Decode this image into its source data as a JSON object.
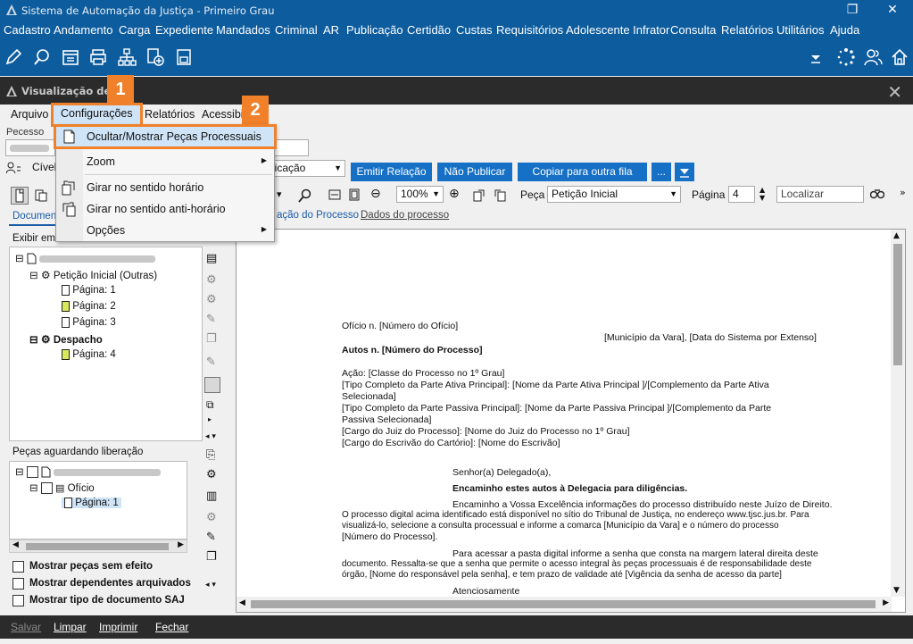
{
  "window": {
    "title": "Sistema de Automação da Justiça - Primeiro Grau",
    "restore_glyph": "❐",
    "close_glyph": "✕"
  },
  "menu": [
    "Cadastro",
    "Andamento",
    "Carga",
    "Expediente",
    "Mandados",
    "Criminal",
    "AR",
    "Publicação",
    "Certidão",
    "Custas",
    "Requisitórios",
    "Adolescente Infrator",
    "Consulta",
    "Relatórios",
    "Utilitários",
    "Ajuda"
  ],
  "dialog": {
    "title": "Visualização de Au",
    "close_glyph": "✕",
    "menu": [
      "Arquivo",
      "Configurações",
      "Relatórios",
      "Acessibi"
    ],
    "callouts": [
      "1",
      "2"
    ],
    "process_label": "Pecesso",
    "area_label": "Cível",
    "publication_select": "licação",
    "buttons": {
      "emitir": "Emitir Relação",
      "nao_publicar": "Não Publicar",
      "copiar": "Copiar para outra fila",
      "more": "...",
      "filter_icon": "filter-icon"
    }
  },
  "popup_menu": {
    "items": [
      {
        "label": "Ocultar/Mostrar Peças Processuais",
        "arrow": ""
      },
      {
        "label": "Zoom",
        "arrow": "▶"
      },
      {
        "label": "Girar no sentido horário",
        "arrow": ""
      },
      {
        "label": "Girar no sentido anti-horário",
        "arrow": ""
      },
      {
        "label": "Opções",
        "arrow": "▶"
      }
    ]
  },
  "viewer_toolbar": {
    "zoom": "100%",
    "peca_label": "Peça",
    "peca_value": "Petição Inicial",
    "pagina_label": "Página",
    "pagina_value": "4",
    "localizar_placeholder": "Localizar"
  },
  "tabs": {
    "left_tab": "Documen",
    "view_tab": "ação do Processo",
    "data_tab": "Dados do processo",
    "exibir": "Exibir em"
  },
  "tree": {
    "peticao": "Petição Inicial (Outras)",
    "pages1": [
      "Página: 1",
      "Página: 2",
      "Página: 3"
    ],
    "despacho": "Despacho",
    "page4": "Página: 4"
  },
  "pending": {
    "header": "Peças aguardando liberação",
    "oficio": "Ofício",
    "page": "Página: 1"
  },
  "options": [
    "Mostrar peças sem efeito",
    "Mostrar dependentes arquivados",
    "Mostrar tipo de documento SAJ"
  ],
  "document": {
    "oficio": "Ofício n. [Número do Ofício]",
    "municipio": "[Município da Vara], [Data do Sistema por Extenso]",
    "autos": "Autos n. [Número do Processo]",
    "lines1": [
      "Ação: [Classe do Processo no 1º Grau]",
      "[Tipo Completo da Parte Ativa Principal]: [Nome da Parte Ativa Principal ]/[Complemento da Parte Ativa",
      "Selecionada]",
      "[Tipo Completo da Parte Passiva Principal]: [Nome da Parte Passiva Principal ]/[Complemento da Parte",
      "Passiva Selecionada]",
      "[Cargo do Juiz do Processo]: [Nome do Juiz do Processo no 1º Grau]",
      "[Cargo do Escrivão do Cartório]: [Nome do Escrivão]"
    ],
    "senhor": "Senhor(a) Delegado(a),",
    "encaminho": "Encaminho estes autos à Delegacia para diligências.",
    "lines2": [
      "Encaminho a Vossa Excelência informações do processo distribuído neste Juízo de Direito.",
      "O processo digital acima identificado está disponível no sítio do Tribunal de Justiça, no endereço www.tjsc.jus.br. Para",
      "visualizá-lo, selecione a consulta processual e informe a comarca  [Município da Vara] e o número do processo",
      "[Número do Processo]."
    ],
    "lines3": [
      "Para acessar a pasta digital informe a senha que consta na margem lateral direita deste",
      "documento. Ressalta-se que a senha que permite o acesso integral às peças processuais é de responsabilidade deste",
      "órgão, [Nome do responsável pela senha], e tem prazo de validade até [Vigência da senha de acesso da parte]"
    ],
    "atenciosamente": "Atenciosamente"
  },
  "statusbar": [
    "Salvar",
    "Limpar",
    "Imprimir",
    "Fechar"
  ]
}
